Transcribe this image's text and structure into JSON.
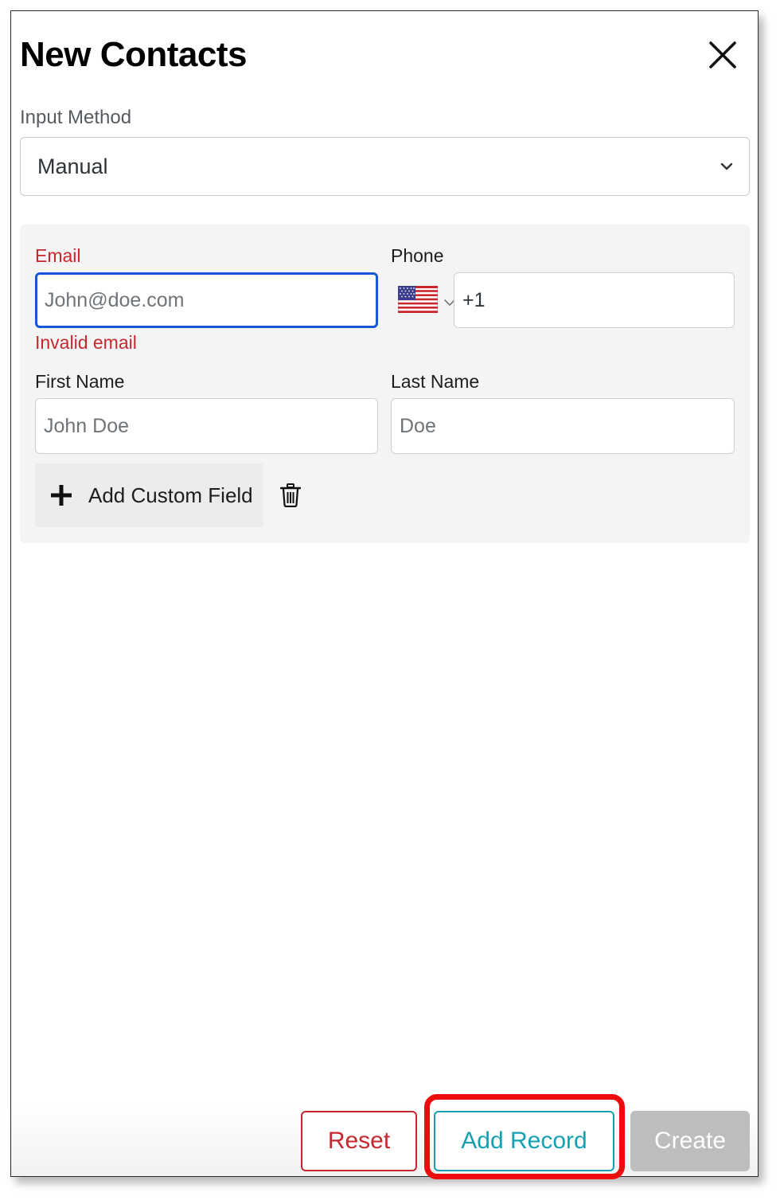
{
  "dialog": {
    "title": "New Contacts"
  },
  "input_method": {
    "label": "Input Method",
    "selected": "Manual"
  },
  "form": {
    "email": {
      "label": "Email",
      "placeholder": "John@doe.com",
      "value": "",
      "error": "Invalid email"
    },
    "phone": {
      "label": "Phone",
      "country_flag": "us-flag-icon",
      "value": "+1"
    },
    "first_name": {
      "label": "First Name",
      "placeholder": "John Doe",
      "value": ""
    },
    "last_name": {
      "label": "Last Name",
      "placeholder": "Doe",
      "value": ""
    },
    "add_custom_field_label": "Add Custom Field"
  },
  "footer": {
    "reset_label": "Reset",
    "add_record_label": "Add Record",
    "create_label": "Create"
  },
  "colors": {
    "error": "#c5282f",
    "focus": "#1557d6",
    "teal": "#16a1b3",
    "disabled": "#bdbdbd",
    "highlight": "#ec0c0c"
  }
}
